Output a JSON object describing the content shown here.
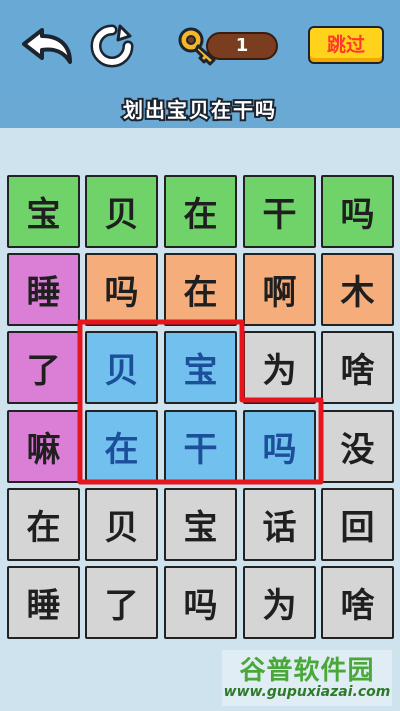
{
  "header": {
    "back_icon": "undo-arrow-icon",
    "refresh_icon": "refresh-icon",
    "hint": {
      "icon": "key-icon",
      "count": "1"
    },
    "skip_label": "跳过"
  },
  "title": "划出宝贝在干吗",
  "grid": {
    "rows": [
      [
        {
          "ch": "宝",
          "color": "green"
        },
        {
          "ch": "贝",
          "color": "green"
        },
        {
          "ch": "在",
          "color": "green"
        },
        {
          "ch": "干",
          "color": "green"
        },
        {
          "ch": "吗",
          "color": "green"
        }
      ],
      [
        {
          "ch": "睡",
          "color": "pink"
        },
        {
          "ch": "吗",
          "color": "orange"
        },
        {
          "ch": "在",
          "color": "orange"
        },
        {
          "ch": "啊",
          "color": "orange"
        },
        {
          "ch": "木",
          "color": "orange"
        }
      ],
      [
        {
          "ch": "了",
          "color": "pink"
        },
        {
          "ch": "贝",
          "color": "blue"
        },
        {
          "ch": "宝",
          "color": "blue"
        },
        {
          "ch": "为",
          "color": "gray"
        },
        {
          "ch": "啥",
          "color": "gray"
        }
      ],
      [
        {
          "ch": "嘛",
          "color": "pink"
        },
        {
          "ch": "在",
          "color": "blue"
        },
        {
          "ch": "干",
          "color": "blue"
        },
        {
          "ch": "吗",
          "color": "blue"
        },
        {
          "ch": "没",
          "color": "gray"
        }
      ],
      [
        {
          "ch": "在",
          "color": "gray"
        },
        {
          "ch": "贝",
          "color": "gray"
        },
        {
          "ch": "宝",
          "color": "gray"
        },
        {
          "ch": "话",
          "color": "gray"
        },
        {
          "ch": "回",
          "color": "gray"
        }
      ],
      [
        {
          "ch": "睡",
          "color": "gray"
        },
        {
          "ch": "了",
          "color": "gray"
        },
        {
          "ch": "吗",
          "color": "gray"
        },
        {
          "ch": "为",
          "color": "gray"
        },
        {
          "ch": "啥",
          "color": "gray"
        }
      ]
    ],
    "selection_color": "#e8141b"
  },
  "watermark": {
    "title": "谷普软件园",
    "url": "www.gupuxiazai.com"
  }
}
